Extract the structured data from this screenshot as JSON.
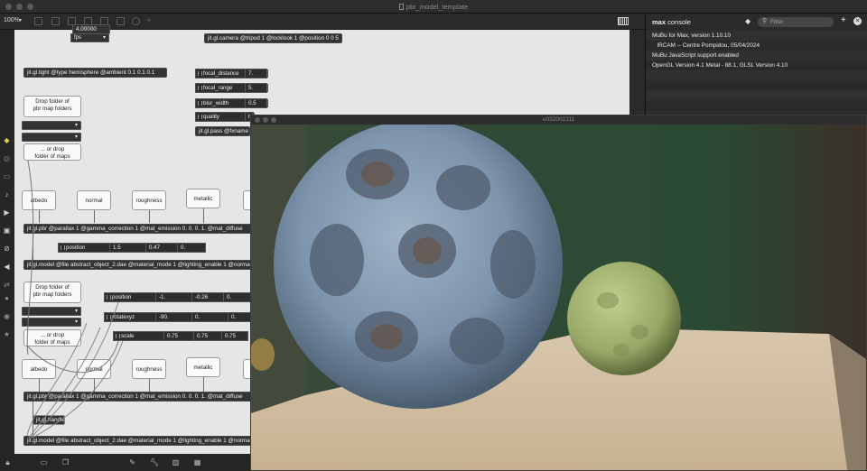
{
  "window": {
    "title": "pbr_model_template"
  },
  "toolbar": {
    "zoom": "100%"
  },
  "canvas": {
    "top_left_number": "4.00000",
    "fps_label": "fps",
    "camera": "jit.gl.camera @tripod 1 @locklook 1 @position 0 0 5",
    "light": "jit.gl.light @type hemisphere @ambient 0.1 0.1 0.1",
    "focal_distance": {
      "name": "focal_distance",
      "value": "7."
    },
    "focal_range": {
      "name": "focal_range",
      "value": "5."
    },
    "blur_width": {
      "name": "blur_width",
      "value": "0.5"
    },
    "quality": {
      "name": "quality",
      "value": "hi"
    },
    "pass": "jit.gl.pass @fxname",
    "drop1": {
      "line1": "Drop folder of",
      "line2": "pbr map folders"
    },
    "ordrop1": {
      "line1": "... or drop",
      "line2": "folder of maps"
    },
    "maps1": [
      "albedo",
      "normal",
      "roughness",
      "metallic",
      "ao"
    ],
    "pbr1": "jit.gl.pbr @parallax 1 @gamma_correction 1 @mat_emission 0. 0. 0. 1. @mat_diffuse",
    "position1": {
      "name": "position",
      "values": [
        "1.5",
        "0.47",
        "0."
      ]
    },
    "model1": "jit.gl.model @file abstract_object_2.dae @material_mode 1 @lighting_enable 1 @normalize",
    "drop2": {
      "line1": "Drop folder of",
      "line2": "pbr map folders"
    },
    "ordrop2": {
      "line1": "... or drop",
      "line2": "folder of maps"
    },
    "position2": {
      "name": "position",
      "values": [
        "-1.",
        "-0.26",
        "0."
      ]
    },
    "rotatexyz": {
      "name": "rotatexyz",
      "values": [
        "-90.",
        "0.",
        "0."
      ]
    },
    "scale": {
      "name": "scale",
      "values": [
        "0.75",
        "0.75",
        "0.75"
      ]
    },
    "maps2": [
      "albedo",
      "normal",
      "roughness",
      "metallic",
      "ao"
    ],
    "pbr2": "jit.gl.pbr @parallax 1 @gamma_correction 1 @mat_emission 0. 0. 0. 1. @mat_diffuse",
    "handle": "jit.gl.handle",
    "model2": "jit.gl.model @file abstract_object_2.dae @material_mode 1 @lighting_enable 1 @normalize"
  },
  "console": {
    "title_bold": "max",
    "title_rest": "console",
    "filter_placeholder": "Filter",
    "lines": [
      "MuBu for Max, version 1.10.10",
      "   IRCAM -- Centre Pompidou, 05/04/2024",
      "MuBu JavaScript support enabled",
      "OpenGL Version 4.1 Metal - 88.1, GLSL Version 4.10"
    ]
  },
  "render_window": {
    "title": "u032002111"
  },
  "icons": {
    "sidebar": [
      "object-icon",
      "target-icon",
      "window-icon",
      "note-icon",
      "play-icon",
      "image-icon",
      "patch-icon",
      "hand-icon",
      "arrows-icon",
      "circle-icon",
      "circle2-icon",
      "star-icon"
    ],
    "bottom": [
      "lock-icon",
      "presentation-icon",
      "windows-icon",
      "debug-icon",
      "wrench-icon",
      "piano-icon",
      "grid-icon"
    ]
  }
}
